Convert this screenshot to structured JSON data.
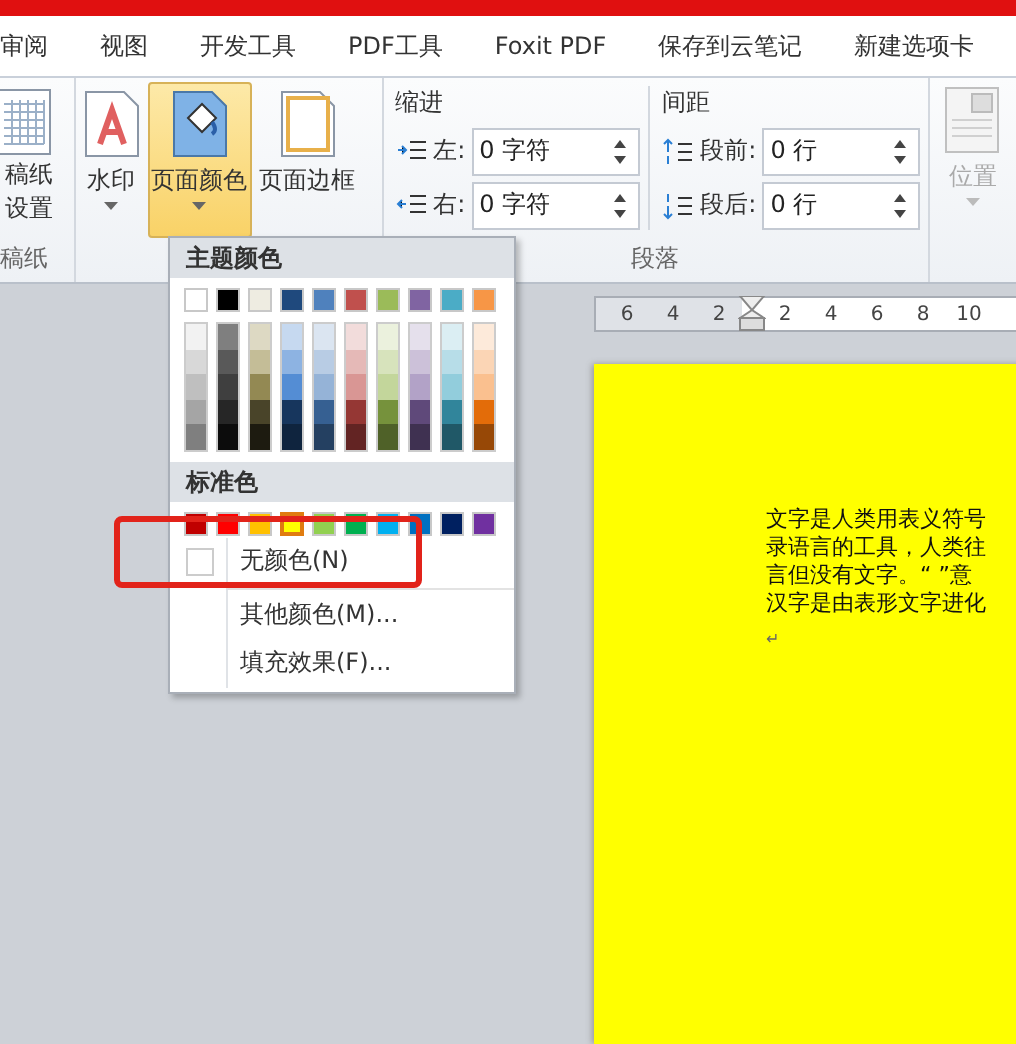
{
  "tabs": [
    {
      "label": "审阅"
    },
    {
      "label": "视图"
    },
    {
      "label": "开发工具"
    },
    {
      "label": "PDF工具"
    },
    {
      "label": "Foxit PDF"
    },
    {
      "label": "保存到云笔记"
    },
    {
      "label": "新建选项卡"
    }
  ],
  "ribbon": {
    "manuscript_group": {
      "button_lines": [
        "稿纸",
        "设置"
      ],
      "group_label": "稿纸"
    },
    "background_group": {
      "buttons": [
        {
          "kind": "watermark",
          "label": "水印",
          "dropdown": true,
          "pressed": false
        },
        {
          "kind": "page_color",
          "label": "页面颜色",
          "dropdown": true,
          "pressed": true
        },
        {
          "kind": "page_border",
          "label": "页面边框",
          "dropdown": false,
          "pressed": false
        }
      ]
    },
    "paragraph_group": {
      "indent": {
        "heading": "缩进",
        "fields": [
          {
            "kind": "left",
            "label": "左:",
            "value": "0 字符"
          },
          {
            "kind": "right",
            "label": "右:",
            "value": "0 字符"
          }
        ]
      },
      "spacing": {
        "heading": "间距",
        "fields": [
          {
            "kind": "before",
            "label": "段前:",
            "value": "0 行"
          },
          {
            "kind": "after",
            "label": "段后:",
            "value": "0 行"
          }
        ]
      },
      "group_label": "段落"
    },
    "position_button": {
      "label": "位置",
      "disabled": true
    }
  },
  "ruler": {
    "left_ticks": [
      "6",
      "4",
      "2"
    ],
    "right_ticks": [
      "2",
      "4",
      "6",
      "8",
      "10"
    ]
  },
  "document": {
    "lines": [
      "文字是人类用表义符号",
      "录语言的工具，人类往",
      "言但没有文字。“ ”意",
      "汉字是由表形文字进化"
    ],
    "paragraph_mark": "↵"
  },
  "color_menu": {
    "theme_heading": "主题颜色",
    "theme_colors": [
      {
        "color": "#ffffff",
        "shades": [
          {
            "color": "#f2f2f2"
          },
          {
            "color": "#d8d8d8"
          },
          {
            "color": "#bfbfbf"
          },
          {
            "color": "#a5a5a5"
          },
          {
            "color": "#7f7f7f"
          }
        ]
      },
      {
        "color": "#000000",
        "shades": [
          {
            "color": "#7f7f7f"
          },
          {
            "color": "#595959"
          },
          {
            "color": "#3f3f3f"
          },
          {
            "color": "#262626"
          },
          {
            "color": "#0c0c0c"
          }
        ]
      },
      {
        "color": "#eeece1",
        "shades": [
          {
            "color": "#ddd9c3"
          },
          {
            "color": "#c4bd97"
          },
          {
            "color": "#938953"
          },
          {
            "color": "#494429"
          },
          {
            "color": "#1d1b10"
          }
        ]
      },
      {
        "color": "#1f497d",
        "shades": [
          {
            "color": "#c6d9f0"
          },
          {
            "color": "#8db3e2"
          },
          {
            "color": "#548dd4"
          },
          {
            "color": "#17365d"
          },
          {
            "color": "#0f243e"
          }
        ]
      },
      {
        "color": "#4f81bd",
        "shades": [
          {
            "color": "#dbe5f1"
          },
          {
            "color": "#b8cce4"
          },
          {
            "color": "#95b3d7"
          },
          {
            "color": "#366092"
          },
          {
            "color": "#244061"
          }
        ]
      },
      {
        "color": "#c0504d",
        "shades": [
          {
            "color": "#f2dcdb"
          },
          {
            "color": "#e5b9b7"
          },
          {
            "color": "#d99694"
          },
          {
            "color": "#953734"
          },
          {
            "color": "#632423"
          }
        ]
      },
      {
        "color": "#9bbb59",
        "shades": [
          {
            "color": "#ebf1dd"
          },
          {
            "color": "#d7e3bc"
          },
          {
            "color": "#c3d69b"
          },
          {
            "color": "#76923c"
          },
          {
            "color": "#4f6128"
          }
        ]
      },
      {
        "color": "#8064a2",
        "shades": [
          {
            "color": "#e5e0ec"
          },
          {
            "color": "#ccc1d9"
          },
          {
            "color": "#b2a2c7"
          },
          {
            "color": "#5f497a"
          },
          {
            "color": "#3f3151"
          }
        ]
      },
      {
        "color": "#4bacc6",
        "shades": [
          {
            "color": "#dbeef3"
          },
          {
            "color": "#b7dde8"
          },
          {
            "color": "#92cddc"
          },
          {
            "color": "#31859b"
          },
          {
            "color": "#205867"
          }
        ]
      },
      {
        "color": "#f79646",
        "shades": [
          {
            "color": "#fdeada"
          },
          {
            "color": "#fbd5b5"
          },
          {
            "color": "#fac08f"
          },
          {
            "color": "#e36c09"
          },
          {
            "color": "#974806"
          }
        ]
      }
    ],
    "standard_heading": "标准色",
    "standard_colors": [
      {
        "color": "#c00000",
        "selected": false
      },
      {
        "color": "#ff0000",
        "selected": false
      },
      {
        "color": "#ffc000",
        "selected": false
      },
      {
        "color": "#ffff00",
        "selected": true
      },
      {
        "color": "#92d050",
        "selected": false
      },
      {
        "color": "#00b050",
        "selected": false
      },
      {
        "color": "#00b0f0",
        "selected": false
      },
      {
        "color": "#0070c0",
        "selected": false
      },
      {
        "color": "#002060",
        "selected": false
      },
      {
        "color": "#7030a0",
        "selected": false
      }
    ],
    "no_color": "无颜色(N)",
    "items": [
      "其他颜色(M)...",
      "填充效果(F)..."
    ]
  }
}
